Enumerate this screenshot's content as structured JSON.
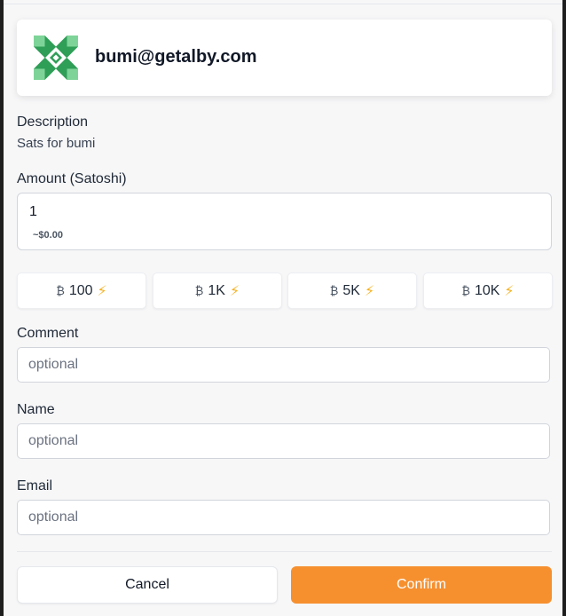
{
  "header": {
    "title": "bumi@getalby.com",
    "avatar_icon": "identicon-avatar",
    "avatar_colors": {
      "dark": "#2f9e57",
      "light": "#7ed498",
      "bg": "#ffffff"
    }
  },
  "description": {
    "label": "Description",
    "value": "Sats for bumi"
  },
  "amount": {
    "label": "Amount (Satoshi)",
    "value": "1",
    "fiat": "~$0.00"
  },
  "presets": [
    {
      "label": "100",
      "icon": "lightning-icon"
    },
    {
      "label": "1K",
      "icon": "lightning-icon"
    },
    {
      "label": "5K",
      "icon": "lightning-icon"
    },
    {
      "label": "10K",
      "icon": "lightning-icon"
    }
  ],
  "comment": {
    "label": "Comment",
    "placeholder": "optional"
  },
  "name": {
    "label": "Name",
    "placeholder": "optional"
  },
  "email": {
    "label": "Email",
    "placeholder": "optional"
  },
  "actions": {
    "cancel": "Cancel",
    "confirm": "Confirm"
  },
  "colors": {
    "accent": "#f6902f",
    "bolt": "#f7b224"
  }
}
